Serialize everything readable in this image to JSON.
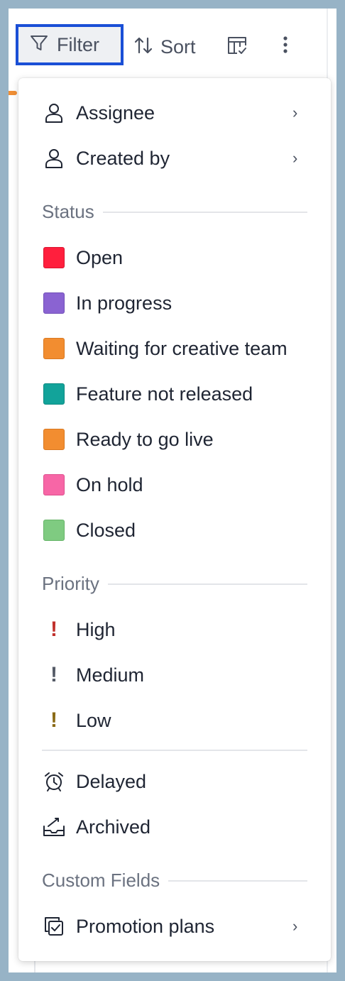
{
  "toolbar": {
    "filter_label": "Filter",
    "sort_label": "Sort"
  },
  "menu": {
    "assignee": {
      "label": "Assignee",
      "icon": "user-icon"
    },
    "created_by": {
      "label": "Created by",
      "icon": "user-icon"
    },
    "status_title": "Status",
    "status": [
      {
        "label": "Open",
        "color": "#ff1f3d"
      },
      {
        "label": "In progress",
        "color": "#8a63d2"
      },
      {
        "label": "Waiting for creative team",
        "color": "#f28d30"
      },
      {
        "label": "Feature not released",
        "color": "#12a39a"
      },
      {
        "label": "Ready to go live",
        "color": "#f28d30"
      },
      {
        "label": "On hold",
        "color": "#f766a6"
      },
      {
        "label": "Closed",
        "color": "#7fcb81"
      }
    ],
    "priority_title": "Priority",
    "priority": [
      {
        "label": "High",
        "color": "#c0302c"
      },
      {
        "label": "Medium",
        "color": "#545a66"
      },
      {
        "label": "Low",
        "color": "#8a6a16"
      }
    ],
    "delayed": {
      "label": "Delayed",
      "icon": "alarm-clock-icon"
    },
    "archived": {
      "label": "Archived",
      "icon": "archive-tray-icon"
    },
    "custom_title": "Custom Fields",
    "promotion": {
      "label": "Promotion plans",
      "icon": "checkbox-stack-icon"
    }
  }
}
